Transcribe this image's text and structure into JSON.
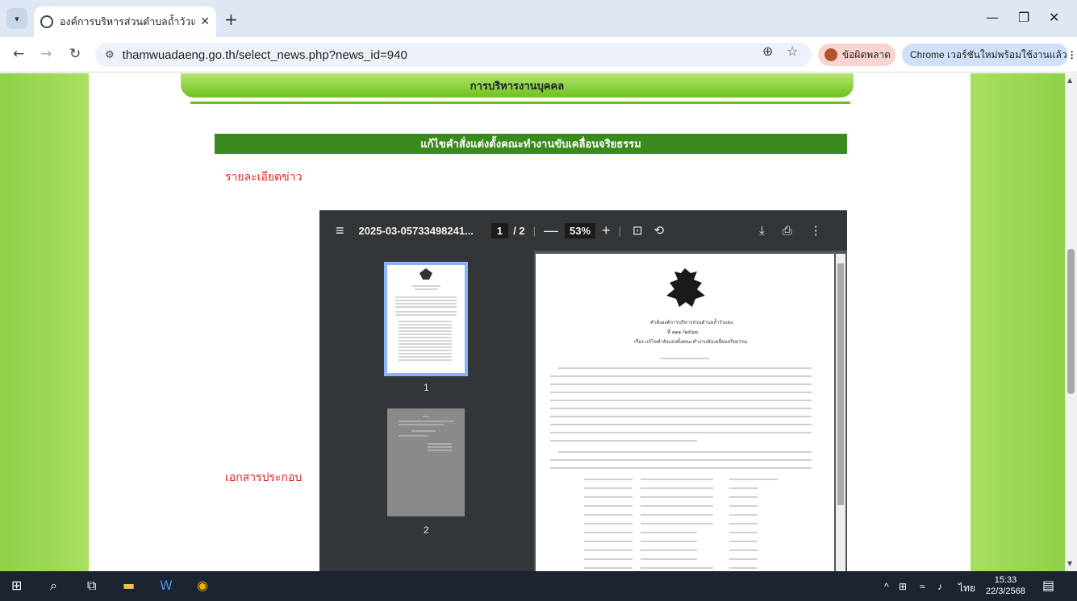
{
  "browser": {
    "tab_title": "องค์การบริหารส่วนตำบลถ้ำวัวแดง อำ",
    "url": "thamwuadaeng.go.th/select_news.php?news_id=940",
    "error_label": "ข้อผิดพลาด",
    "update_label": "Chrome เวอร์ชันใหม่พร้อมใช้งานแล้ว"
  },
  "page": {
    "section_header": "การบริหารงานบุคคล",
    "news_title": "แก้ไขคำสั่งแต่งตั้งคณะทำงานขับเคลื่อนจริยธรรม",
    "details_label": "รายละเอียดข่าว",
    "attachments_label": "เอกสารประกอบ"
  },
  "pdf": {
    "filename": "2025-03-05733498241...",
    "current_page": "1",
    "total_pages": "/ 2",
    "zoom": "53%",
    "thumb_labels": [
      "1",
      "2"
    ],
    "doc_heading_1": "คำสั่งองค์การบริหารส่วนตำบลถ้ำวัวแดง",
    "doc_heading_2": "ที่ ๑๑๑ /๒๕๖๘",
    "doc_heading_3": "เรื่อง แก้ไขคำสั่งแต่งตั้งคณะทำงานขับเคลื่อนจริยธรรม"
  },
  "taskbar": {
    "lang": "ไทย",
    "time": "15:33",
    "date": "22/3/2568"
  }
}
